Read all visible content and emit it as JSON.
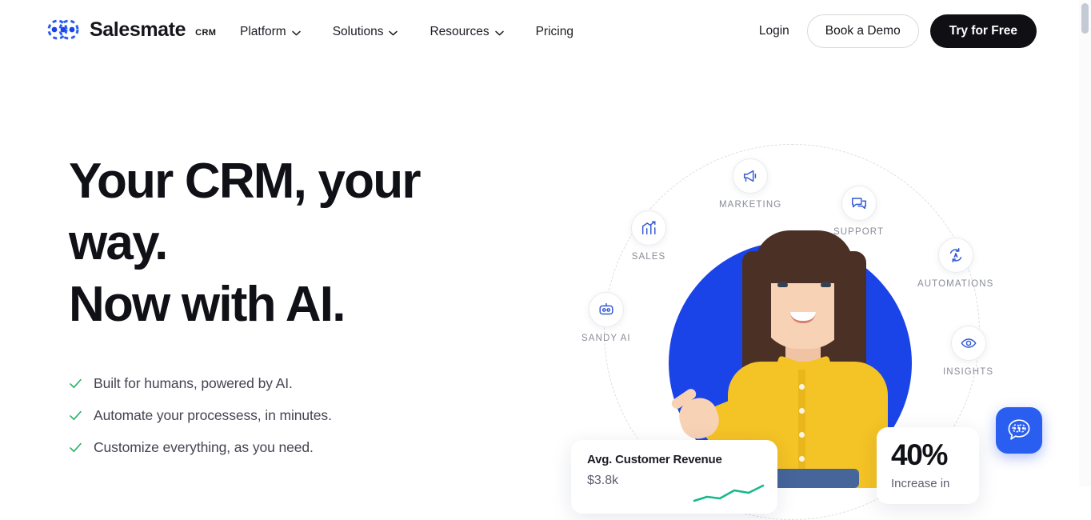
{
  "header": {
    "brand": {
      "name": "Salesmate",
      "suffix": "CRM",
      "logo_icon": "salesmate-logo-icon"
    },
    "nav": [
      {
        "label": "Platform",
        "has_caret": true,
        "icon": "chevron-down-icon"
      },
      {
        "label": "Solutions",
        "has_caret": true,
        "icon": "chevron-down-icon"
      },
      {
        "label": "Resources",
        "has_caret": true,
        "icon": "chevron-down-icon"
      },
      {
        "label": "Pricing",
        "has_caret": false,
        "icon": ""
      }
    ],
    "login_label": "Login",
    "demo_label": "Book a Demo",
    "free_label": "Try for Free"
  },
  "hero": {
    "title_lines": [
      "Your CRM, your",
      "way.",
      "Now with AI."
    ],
    "bullets": [
      {
        "icon": "check-icon",
        "text": "Built for humans, powered by AI."
      },
      {
        "icon": "check-icon",
        "text": "Automate your processess, in minutes."
      },
      {
        "icon": "check-icon",
        "text": "Customize everything, as you need."
      }
    ]
  },
  "illustration": {
    "nodes": [
      {
        "label": "MARKETING",
        "icon": "megaphone-icon"
      },
      {
        "label": "SUPPORT",
        "icon": "chat-bubbles-icon"
      },
      {
        "label": "AUTOMATIONS",
        "icon": "automation-refresh-icon"
      },
      {
        "label": "INSIGHTS",
        "icon": "eye-icon"
      },
      {
        "label": "SALES",
        "icon": "bar-chart-up-icon"
      },
      {
        "label": "SANDY AI",
        "icon": "robot-icon"
      }
    ],
    "cards": {
      "revenue": {
        "title": "Avg. Customer Revenue",
        "value": "$3.8k",
        "icon": "sparkline-icon"
      },
      "percent": {
        "value": "40%",
        "label": "Increase in"
      }
    }
  },
  "chat": {
    "icon": "chat-logo-icon",
    "aria": "Open chat"
  },
  "colors": {
    "brand_blue": "#1a44e8",
    "chat_blue": "#2a5ef0",
    "icon_blue": "#3358d4",
    "check_green": "#34b36b",
    "shirt_yellow": "#f4c325",
    "dark_button": "#101014",
    "text_primary": "#101017",
    "text_muted": "#5d5f6d",
    "label_grey": "#8a8c98"
  },
  "scrollbar": {
    "position": "top"
  }
}
